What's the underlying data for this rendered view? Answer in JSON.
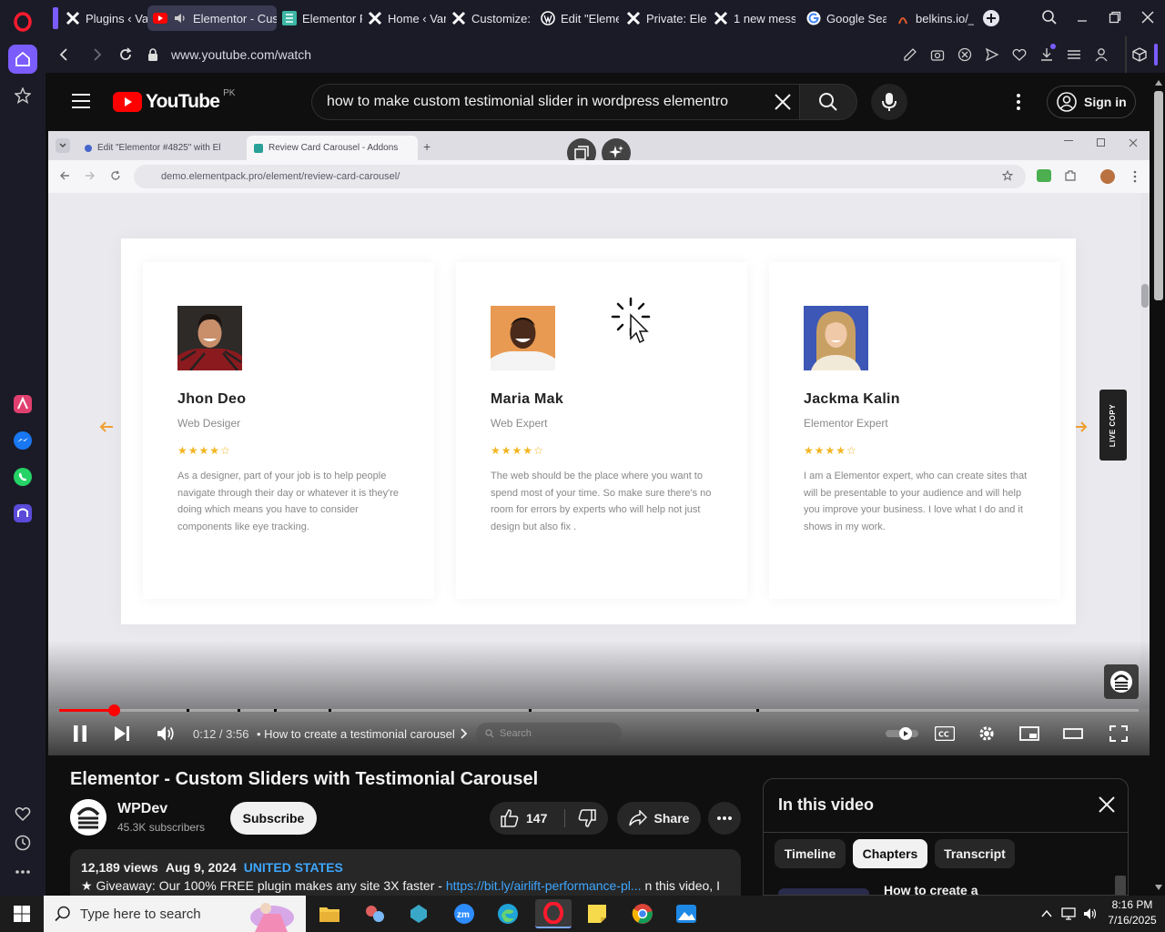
{
  "browser": {
    "tabs": [
      {
        "label": "Plugins ‹ Var",
        "icon": "elementor-x-icon"
      },
      {
        "label": "Elementor - Cust",
        "icon": "youtube-icon"
      },
      {
        "label": "Elementor R",
        "icon": "elementor-e-icon"
      },
      {
        "label": "Home ‹ Varti",
        "icon": "elementor-x-icon"
      },
      {
        "label": "Customize: V",
        "icon": "elementor-x-icon"
      },
      {
        "label": "Edit \"Elemen",
        "icon": "wordpress-icon"
      },
      {
        "label": "Private: Elem",
        "icon": "elementor-x-icon"
      },
      {
        "label": "1 new messa",
        "icon": "elementor-x-icon"
      },
      {
        "label": "Google Sear",
        "icon": "google-icon"
      },
      {
        "label": "belkins.io/_a",
        "icon": "belkins-icon"
      }
    ],
    "url": "www.youtube.com/watch"
  },
  "youtube": {
    "logo_text": "YouTube",
    "region": "PK",
    "search_value": "how to make custom testimonial  slider in wordpress elementro",
    "sign_in": "Sign in"
  },
  "video_frame": {
    "tabs": [
      "Edit \"Elementor #4825\" with El",
      "Review Card Carousel - Addons"
    ],
    "url": "demo.elementpack.pro/element/review-card-carousel/",
    "live_copy": "LIVE COPY",
    "cards": [
      {
        "name": "Jhon Deo",
        "role": "Web Desiger",
        "stars": "★★★★☆",
        "text": "As a designer, part of your job is to help people navigate through their day or whatever it is they're doing which means you have to consider components like eye tracking."
      },
      {
        "name": "Maria Mak",
        "role": "Web Expert",
        "stars": "★★★★☆",
        "text": "The web should be the place where you want to spend most of your time. So make sure there's no room for errors by experts who will help not just design but also fix ."
      },
      {
        "name": "Jackma Kalin",
        "role": "Elementor Expert",
        "stars": "★★★★☆",
        "text": "I am a Elementor expert, who can create sites that will be presentable to your audience and will help you improve your business. I love what I do and it shows in my work."
      }
    ],
    "taskbar_search": "Search"
  },
  "player": {
    "time": "0:12 / 3:56",
    "chapter": "• How to create a testimonial carousel",
    "progress": 0.051
  },
  "video": {
    "title": "Elementor - Custom Sliders with Testimonial Carousel",
    "channel": "WPDev",
    "subscribers": "45.3K subscribers",
    "subscribe": "Subscribe",
    "likes": "147",
    "share": "Share",
    "views": "12,189 views",
    "date": "Aug 9, 2024",
    "location": "UNITED STATES",
    "desc_prefix": "★ Giveaway: Our 100% FREE plugin makes any site 3X faster  - ",
    "desc_link": "https://bit.ly/airlift-performance-pl...",
    "desc_suffix": " n this video, I"
  },
  "panel": {
    "title": "In this video",
    "chips": [
      "Timeline",
      "Chapters",
      "Transcript"
    ],
    "selected_chip": "Chapters",
    "first_chapter": "How to create a"
  },
  "taskbar": {
    "search_placeholder": "Type here to search",
    "time": "8:16 PM",
    "date": "7/16/2025"
  },
  "colors": {
    "youtube_red": "#ff0000",
    "opera_red": "#ff1b2d",
    "accent_blue": "#3ea6ff",
    "star_gold": "#f3b521"
  }
}
